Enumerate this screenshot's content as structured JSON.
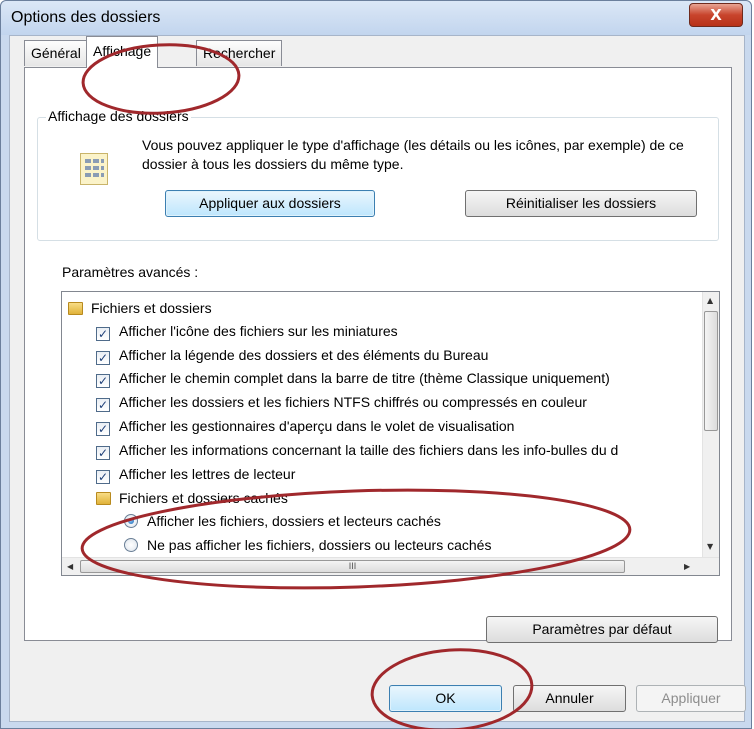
{
  "window": {
    "title": "Options des dossiers",
    "close_glyph": "X"
  },
  "tabs": [
    {
      "label": "Général",
      "active": false
    },
    {
      "label": "Affichage",
      "active": true
    },
    {
      "label": "Rechercher",
      "active": false
    }
  ],
  "folder_view": {
    "group_title": "Affichage des dossiers",
    "description": "Vous pouvez appliquer le type d'affichage (les détails ou les icônes, par exemple) de ce dossier à tous les dossiers du même type.",
    "apply_button": "Appliquer aux dossiers",
    "reset_button": "Réinitialiser les dossiers"
  },
  "advanced": {
    "label": "Paramètres avancés :",
    "items": [
      {
        "type": "folder",
        "label": "Fichiers et dossiers"
      },
      {
        "type": "checkbox",
        "checked": true,
        "label": "Afficher l'icône des fichiers sur les miniatures"
      },
      {
        "type": "checkbox",
        "checked": true,
        "label": "Afficher la légende des dossiers et des éléments du Bureau"
      },
      {
        "type": "checkbox",
        "checked": true,
        "label": "Afficher le chemin complet dans la barre de titre (thème Classique uniquement)"
      },
      {
        "type": "checkbox",
        "checked": true,
        "label": "Afficher les dossiers et les fichiers NTFS chiffrés ou compressés en couleur"
      },
      {
        "type": "checkbox",
        "checked": true,
        "label": "Afficher les gestionnaires d'aperçu dans le volet de visualisation"
      },
      {
        "type": "checkbox",
        "checked": true,
        "label": "Afficher les informations concernant la taille des fichiers dans les info-bulles du d"
      },
      {
        "type": "checkbox",
        "checked": true,
        "label": "Afficher les lettres de lecteur"
      },
      {
        "type": "folder",
        "label": "Fichiers et dossiers cachés"
      },
      {
        "type": "radio",
        "selected": true,
        "label": "Afficher les fichiers, dossiers et lecteurs cachés"
      },
      {
        "type": "radio",
        "selected": false,
        "label": "Ne pas afficher les fichiers, dossiers ou lecteurs cachés"
      }
    ],
    "hscroll_grip": "III",
    "defaults_button": "Paramètres par défaut"
  },
  "footer": {
    "ok": "OK",
    "cancel": "Annuler",
    "apply": "Appliquer"
  },
  "colors": {
    "annotation": "#a0282c",
    "accent": "#3c7fb1"
  }
}
